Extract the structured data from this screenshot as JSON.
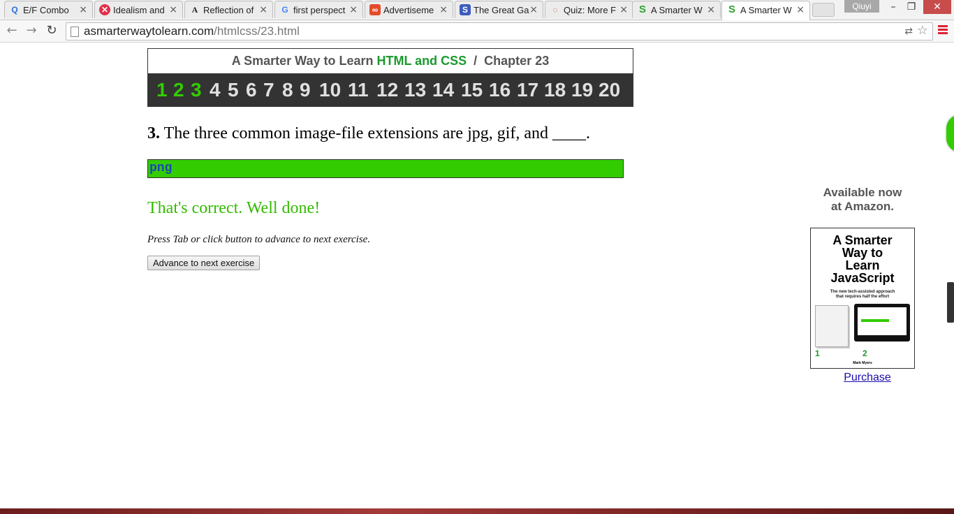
{
  "browser": {
    "tabs": [
      {
        "title": "E/F Combo",
        "favicon": "Q",
        "favicon_color": "#2a6fd6"
      },
      {
        "title": "Idealism and",
        "favicon": "✕",
        "favicon_color": "#e0314b"
      },
      {
        "title": "Reflection of",
        "favicon": "A",
        "favicon_color": "#222222"
      },
      {
        "title": "first perspect",
        "favicon": "G",
        "favicon_color": "#4285f4"
      },
      {
        "title": "Advertiseme",
        "favicon": "∞",
        "favicon_color": "#e34b2a"
      },
      {
        "title": "The Great Ga",
        "favicon": "S",
        "favicon_color": "#3b5bbf"
      },
      {
        "title": "Quiz: More F",
        "favicon": "◌",
        "favicon_color": "#d9342b"
      },
      {
        "title": "A Smarter W",
        "favicon": "S",
        "favicon_color": "#2fa32f"
      },
      {
        "title": "A Smarter W",
        "favicon": "S",
        "favicon_color": "#2fa32f",
        "active": true
      }
    ],
    "user_name": "Qiuyi",
    "window_controls": {
      "minimize": "–",
      "restore": "❐",
      "close": "✕"
    },
    "url_host": "asmarterwaytolearn.com",
    "url_path": "/htmlcss/23.html",
    "icons": {
      "back": "back-arrow-icon",
      "forward": "forward-arrow-icon",
      "reload": "reload-icon",
      "star": "bookmark-star-icon",
      "menu": "hamburger-menu-icon"
    }
  },
  "header": {
    "title_prefix": "A Smarter Way to Learn ",
    "title_highlight": "HTML and CSS",
    "title_suffix": "  /  Chapter 23",
    "exercise_numbers": [
      "1",
      "2",
      "3",
      "4",
      "5",
      "6",
      "7",
      "8",
      "9",
      "10",
      "11",
      "12",
      "13",
      "14",
      "15",
      "16",
      "17",
      "18",
      "19",
      "20"
    ],
    "completed_count": 3
  },
  "exercise": {
    "number": "3.",
    "question": "The three common image-file extensions are jpg, gif, and ____.",
    "answer": "png",
    "feedback": "That's correct. Well done!",
    "instruction": "Press Tab or click button to advance to next exercise.",
    "button_label": "Advance to next exercise"
  },
  "sidebar": {
    "available_line1": "Available now",
    "available_line2": "at Amazon.",
    "book_title_lines": [
      "A Smarter",
      "Way to",
      "Learn",
      "JavaScript"
    ],
    "book_subtitle_line1": "The new tech-assisted approach",
    "book_subtitle_line2": "that requires half the effort",
    "book_step1": "1",
    "book_step2": "2",
    "book_author": "Mark Myers",
    "purchase_label": "Purchase"
  },
  "colors": {
    "accent_green": "#33cc00",
    "title_green": "#1b9a2f",
    "nav_bar": "#333333",
    "link_blue": "#1a0dab"
  }
}
